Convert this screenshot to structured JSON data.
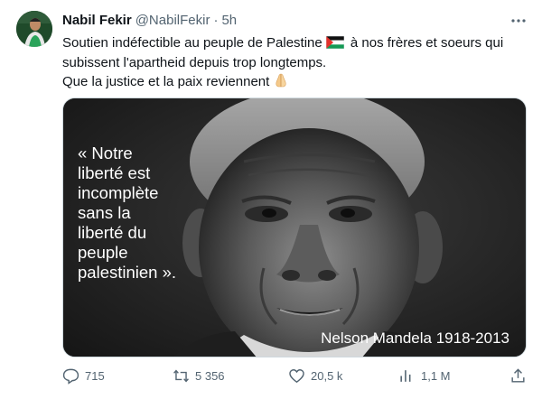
{
  "author": {
    "name": "Nabil Fekir",
    "handle": "@NabilFekir",
    "separator": "·",
    "time": "5h"
  },
  "tweet": {
    "line1_before_flag": "Soutien indéfectible au peuple de Palestine",
    "line1_after_flag": "à nos frères et soeurs qui",
    "line2": "subissent l'apartheid depuis trop longtemps.",
    "line3": "Que la justice et la paix reviennent",
    "flag_emoji": "palestine-flag",
    "hands_emoji": "folded-hands"
  },
  "media": {
    "quote": "« Notre\nliberté est\nincomplète\nsans la\nliberté du\npeuple\npalestinien ».",
    "caption": "Nelson Mandela 1918-2013"
  },
  "actions": {
    "replies": "715",
    "retweets": "5 356",
    "likes": "20,5 k",
    "views": "1,1 M"
  },
  "icons": [
    "more-icon",
    "reply-icon",
    "retweet-icon",
    "like-icon",
    "views-icon",
    "share-icon"
  ],
  "colors": {
    "text": "#0f1419",
    "secondary": "#536471",
    "border": "#cfd9de"
  }
}
